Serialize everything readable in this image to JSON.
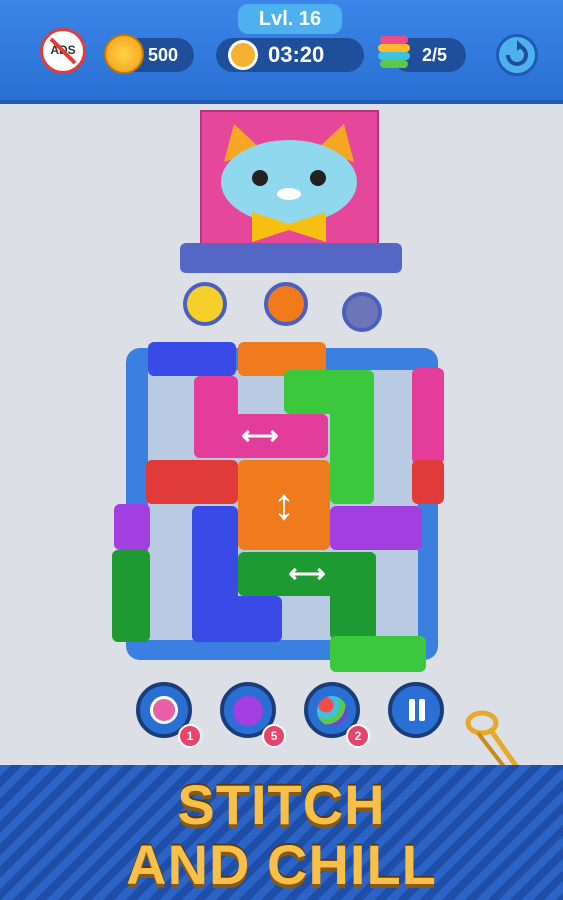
{
  "header": {
    "level_label": "Lvl. 16",
    "no_ads_label": "ADS",
    "coins": "500",
    "timer": "03:20",
    "spool_progress": "2/5"
  },
  "powerups": [
    {
      "name": "Clock",
      "count": "1"
    },
    {
      "name": "Yarn Bomb",
      "count": "5"
    },
    {
      "name": "Color Ball",
      "count": "2"
    }
  ],
  "banner": {
    "line1": "STITCH",
    "line2": "AND CHILL"
  },
  "icons": {
    "no_ads": "no-ads-icon",
    "coin": "coin-icon",
    "timer": "stopwatch-icon",
    "spools": "spool-stack-icon",
    "restart": "restart-icon",
    "pause": "pause-icon",
    "pin": "safety-pin-icon"
  },
  "colors": {
    "header": "#2a6fd3",
    "magenta": "#e43c9b",
    "green": "#3cc83c",
    "orange": "#f07b1d",
    "red": "#e03a3a",
    "purple": "#a33fe0",
    "blue": "#3a4ae6",
    "dark_green": "#1e9a32",
    "slogan": "#f7c04a"
  }
}
